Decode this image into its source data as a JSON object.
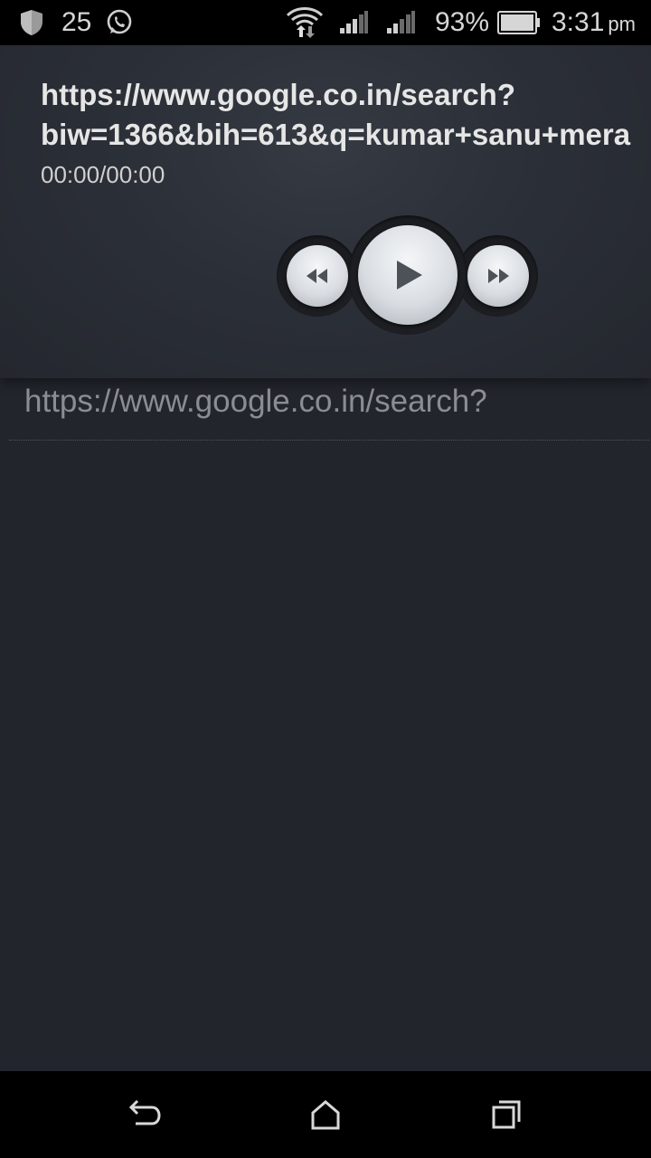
{
  "status_bar": {
    "notification_count": "25",
    "battery_percent": "93%",
    "time": "3:31",
    "time_suffix": "pm",
    "icons": [
      "shield-icon",
      "whatsapp-icon",
      "wifi-icon",
      "signal-icon",
      "signal-icon",
      "battery-icon"
    ]
  },
  "player": {
    "title_line1": "https://www.google.co.in/search?",
    "title_line2": "biw=1366&bih=613&q=kumar+sanu+mera",
    "time_display": "00:00/00:00",
    "controls": {
      "rewind_icon": "rewind-icon",
      "play_icon": "play-icon",
      "fast_forward_icon": "fast-forward-icon"
    }
  },
  "list": {
    "items": [
      {
        "label": "https://www.google.co.in/search?"
      }
    ]
  },
  "nav_bar": {
    "icons": [
      "back-icon",
      "home-icon",
      "recents-icon"
    ]
  },
  "colors": {
    "background": "#22252c",
    "bars": "#000000",
    "title_text": "#e6e6e6",
    "list_text": "#8a8d92"
  }
}
